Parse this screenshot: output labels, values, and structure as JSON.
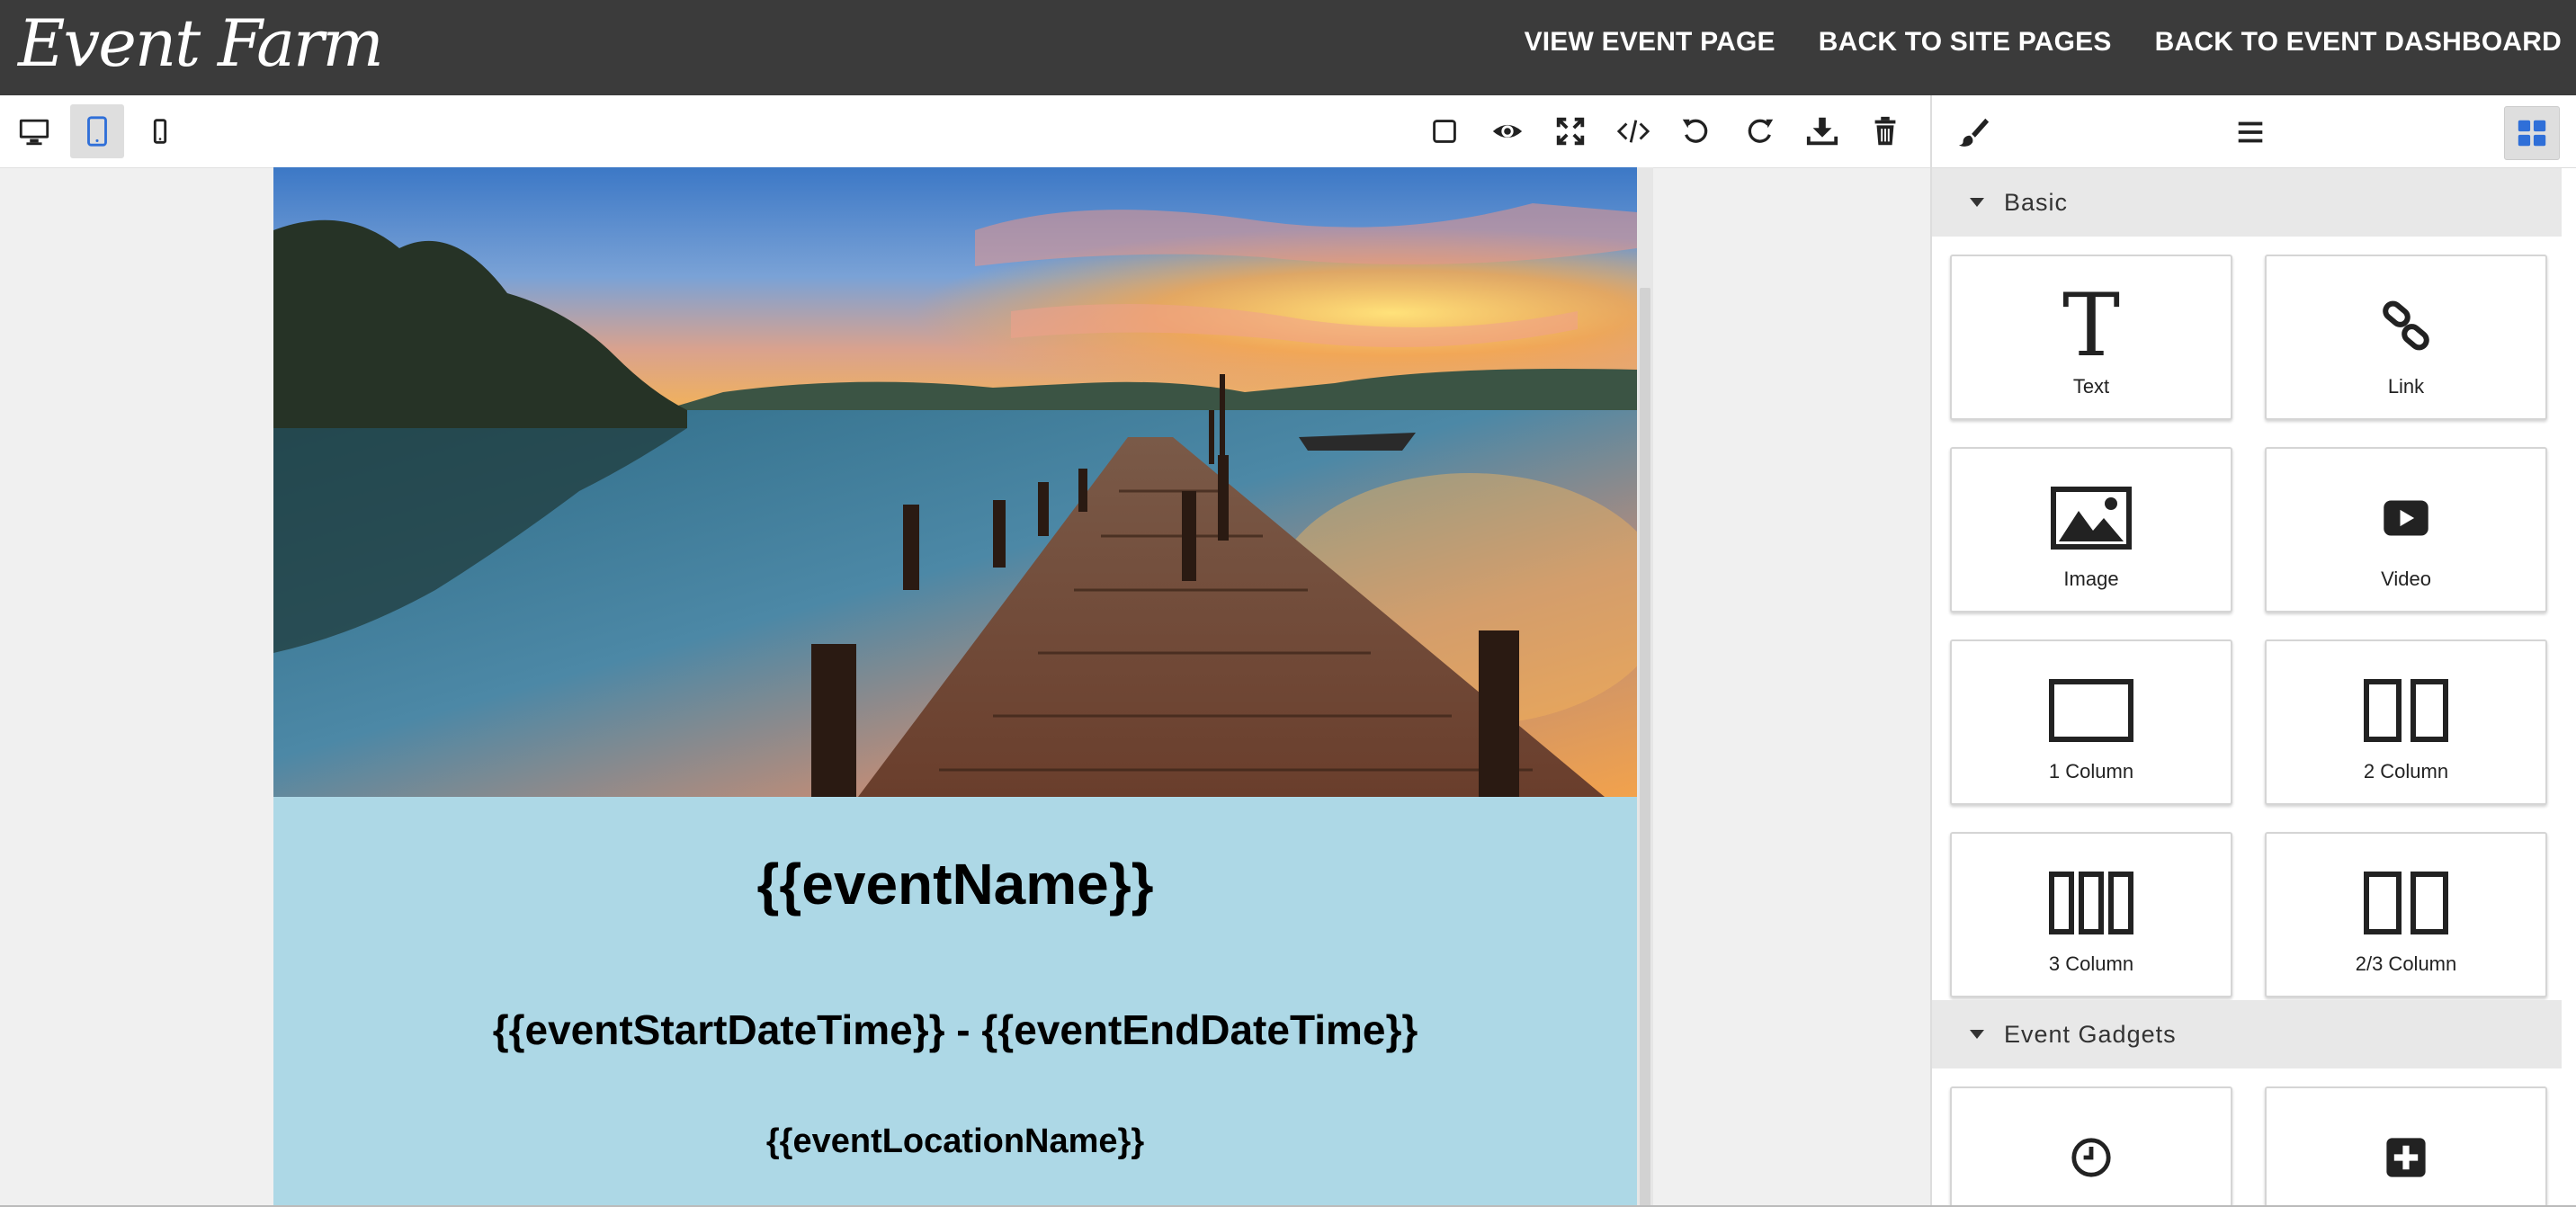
{
  "header": {
    "logo_text": "Event Farm",
    "nav": [
      "VIEW EVENT PAGE",
      "BACK TO SITE PAGES",
      "BACK TO EVENT DASHBOARD"
    ]
  },
  "toolbar": {
    "devices": [
      "desktop-icon",
      "tablet-icon",
      "mobile-icon"
    ],
    "active_device": "tablet",
    "actions": [
      "square-outline-icon",
      "eye-icon",
      "expand-icon",
      "code-icon",
      "undo-icon",
      "redo-icon",
      "download-icon",
      "trash-icon"
    ]
  },
  "panel_tabs": {
    "tabs": [
      "paint-brush-icon",
      "menu-bars-icon",
      "blocks-grid-icon"
    ],
    "active": "blocks-grid-icon"
  },
  "canvas": {
    "event_name": "{{eventName}}",
    "event_dates": "{{eventStartDateTime}} - {{eventEndDateTime}}",
    "event_location": "{{eventLocationName}}",
    "block_bg": "#add8e6"
  },
  "blocks_panel": {
    "basic": {
      "title": "Basic",
      "items": [
        "Text",
        "Link",
        "Image",
        "Video",
        "1 Column",
        "2 Column",
        "3 Column",
        "2/3 Column"
      ]
    },
    "event_gadgets": {
      "title": "Event Gadgets",
      "items": [
        "clock-icon",
        "plus-square-icon"
      ]
    }
  }
}
